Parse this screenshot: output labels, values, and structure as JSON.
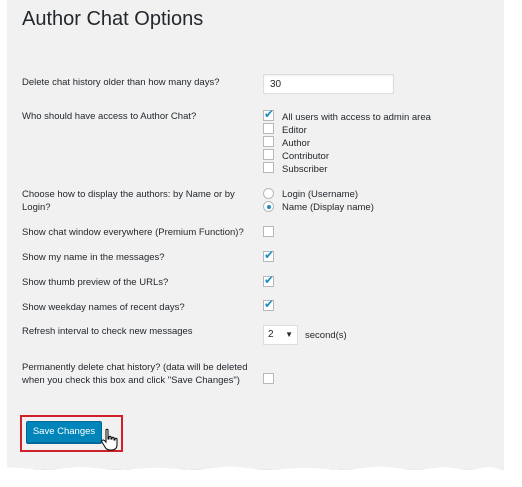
{
  "page": {
    "title": "Author Chat Options"
  },
  "fields": {
    "history_label": "Delete chat history older than how many days?",
    "history_value": "30",
    "access_label": "Who should have access to Author Chat?",
    "access_options": [
      {
        "label": "All users with access to admin area",
        "checked": true
      },
      {
        "label": "Editor",
        "checked": false
      },
      {
        "label": "Author",
        "checked": false
      },
      {
        "label": "Contributor",
        "checked": false
      },
      {
        "label": "Subscriber",
        "checked": false
      }
    ],
    "display_label": "Choose how to display the authors: by Name or by Login?",
    "display_options": [
      {
        "label": "Login (Username)",
        "selected": false
      },
      {
        "label": "Name (Display name)",
        "selected": true
      }
    ],
    "everywhere_label": "Show chat window everywhere (Premium Function)?",
    "everywhere_checked": false,
    "myname_label": "Show my name in the messages?",
    "myname_checked": true,
    "thumb_label": "Show thumb preview of the URLs?",
    "thumb_checked": true,
    "weekday_label": "Show weekday names of recent days?",
    "weekday_checked": true,
    "refresh_label": "Refresh interval to check new messages",
    "refresh_value": "2",
    "refresh_unit": "second(s)",
    "delete_label": "Permanently delete chat history? (data will be deleted when you check this box and click \"Save Changes\")",
    "delete_checked": false
  },
  "actions": {
    "save_label": "Save Changes"
  },
  "colors": {
    "accent": "#0085ba",
    "highlight_frame": "#d0202a",
    "panel_bg": "#f1f1f1"
  }
}
